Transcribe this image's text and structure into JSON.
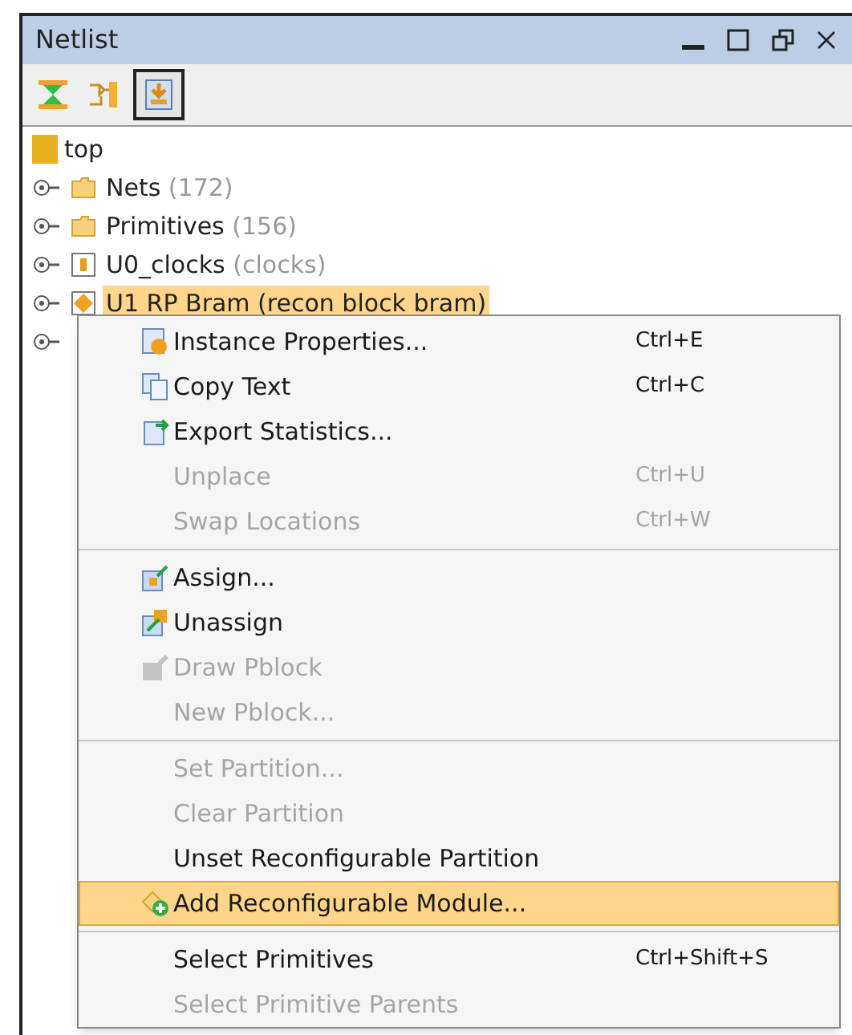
{
  "window": {
    "title": "Netlist"
  },
  "toolbar": [
    {
      "selected": false
    },
    {
      "selected": false
    },
    {
      "selected": true
    }
  ],
  "tree": {
    "label": "top",
    "children": [
      {
        "label": "Nets",
        "detail": "(172)",
        "kind": "folder",
        "selected": false
      },
      {
        "label": "Primitives",
        "detail": "(156)",
        "kind": "folder",
        "selected": false
      },
      {
        "label": "U0_clocks",
        "detail": "(clocks)",
        "kind": "cell",
        "selected": false
      },
      {
        "label": "U1 RP Bram (recon block bram)",
        "kind": "instance",
        "selected": true
      }
    ]
  },
  "context_menu": [
    {
      "kind": "item",
      "label": "Instance Properties...",
      "shortcut": "Ctrl+E",
      "disabled": false,
      "selected": false
    },
    {
      "kind": "item",
      "label": "Copy Text",
      "shortcut": "Ctrl+C",
      "disabled": false,
      "selected": false
    },
    {
      "kind": "item",
      "label": "Export Statistics...",
      "disabled": false,
      "selected": false
    },
    {
      "kind": "item",
      "label": "Unplace",
      "shortcut": "Ctrl+U",
      "disabled": true,
      "selected": false
    },
    {
      "kind": "item",
      "label": "Swap Locations",
      "shortcut": "Ctrl+W",
      "disabled": true,
      "selected": false
    },
    {
      "kind": "separator"
    },
    {
      "kind": "item",
      "label": "Assign...",
      "disabled": false,
      "selected": false
    },
    {
      "kind": "item",
      "label": "Unassign",
      "disabled": false,
      "selected": false
    },
    {
      "kind": "item",
      "label": "Draw Pblock",
      "disabled": true,
      "selected": false
    },
    {
      "kind": "item",
      "label": "New Pblock...",
      "disabled": true,
      "selected": false
    },
    {
      "kind": "separator"
    },
    {
      "kind": "item",
      "label": "Set Partition...",
      "disabled": true,
      "selected": false
    },
    {
      "kind": "item",
      "label": "Clear Partition",
      "disabled": true,
      "selected": false
    },
    {
      "kind": "item",
      "label": "Unset Reconfigurable Partition",
      "disabled": false,
      "selected": false
    },
    {
      "kind": "item",
      "label": "Add Reconfigurable Module...",
      "disabled": false,
      "selected": true
    },
    {
      "kind": "separator"
    },
    {
      "kind": "item",
      "label": "Select Primitives",
      "shortcut": "Ctrl+Shift+S",
      "disabled": false,
      "selected": false
    },
    {
      "kind": "item",
      "label": "Select Primitive Parents",
      "disabled": true,
      "selected": false
    }
  ]
}
